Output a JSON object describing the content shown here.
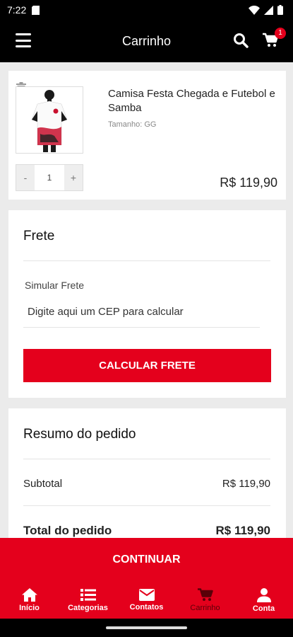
{
  "status_bar": {
    "time": "7:22"
  },
  "header": {
    "title": "Carrinho",
    "cart_count": "1"
  },
  "cart_item": {
    "name": "Camisa Festa Chegada e Futebol e Samba",
    "size": "Tamanho: GG",
    "quantity": "1",
    "minus_label": "-",
    "plus_label": "+",
    "price": "R$ 119,90"
  },
  "shipping": {
    "title": "Frete",
    "field_label": "Simular Frete",
    "field_placeholder": "Digite aqui um CEP para calcular",
    "button_label": "CALCULAR FRETE"
  },
  "summary": {
    "title": "Resumo do pedido",
    "subtotal_label": "Subtotal",
    "subtotal_value": "R$ 119,90",
    "total_label": "Total do pedido",
    "total_value": "R$ 119,90"
  },
  "continue_label": "CONTINUAR",
  "tabs": [
    {
      "label": "Início",
      "icon": "home-icon"
    },
    {
      "label": "Categorias",
      "icon": "list-icon"
    },
    {
      "label": "Contatos",
      "icon": "envelope-icon"
    },
    {
      "label": "Carrinho",
      "icon": "cart-icon",
      "active": true
    },
    {
      "label": "Conta",
      "icon": "user-icon"
    }
  ],
  "colors": {
    "accent": "#e4001c",
    "header_bg": "#000000",
    "active_tab": "#5a0008"
  }
}
